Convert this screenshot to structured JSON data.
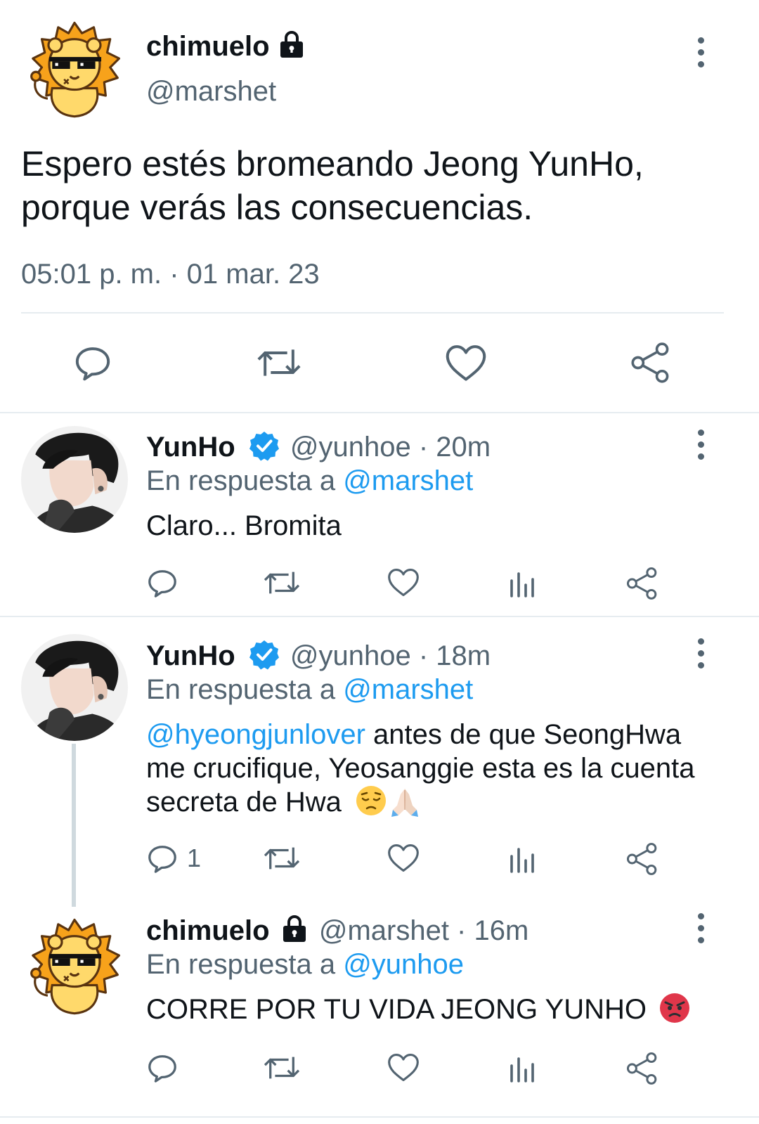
{
  "main_tweet": {
    "display_name": "chimuelo",
    "handle": "@marshet",
    "text_line1": "Espero estés bromeando Jeong YunHo,",
    "text_line2": "porque verás las consecuencias.",
    "timestamp": "05:01 p. m. · 01 mar. 23"
  },
  "replies": [
    {
      "display_name": "YunHo",
      "handle_time": "@yunhoe · 20m",
      "reply_prefix": "En respuesta a",
      "reply_to": "@marshet",
      "text": "Claro... Bromita"
    },
    {
      "display_name": "YunHo",
      "handle_time": "@yunhoe · 18m",
      "reply_prefix": "En respuesta a",
      "reply_to": "@marshet",
      "mention": "@hyeongjunlover",
      "text_line1": " antes de que SeongHwa",
      "text_line2": "me crucifique, Yeosanggie esta es la cuenta",
      "text_line3": "secreta de Hwa",
      "reply_count": "1"
    },
    {
      "display_name": "chimuelo",
      "handle_time": "@marshet · 16m",
      "reply_prefix": "En respuesta a",
      "reply_to": "@yunhoe",
      "text": "CORRE POR TU VIDA JEONG YUNHO"
    }
  ],
  "colors": {
    "text": "#0f1419",
    "secondary": "#536471",
    "link": "#1d9bf0",
    "divider": "#e6ecf0"
  }
}
